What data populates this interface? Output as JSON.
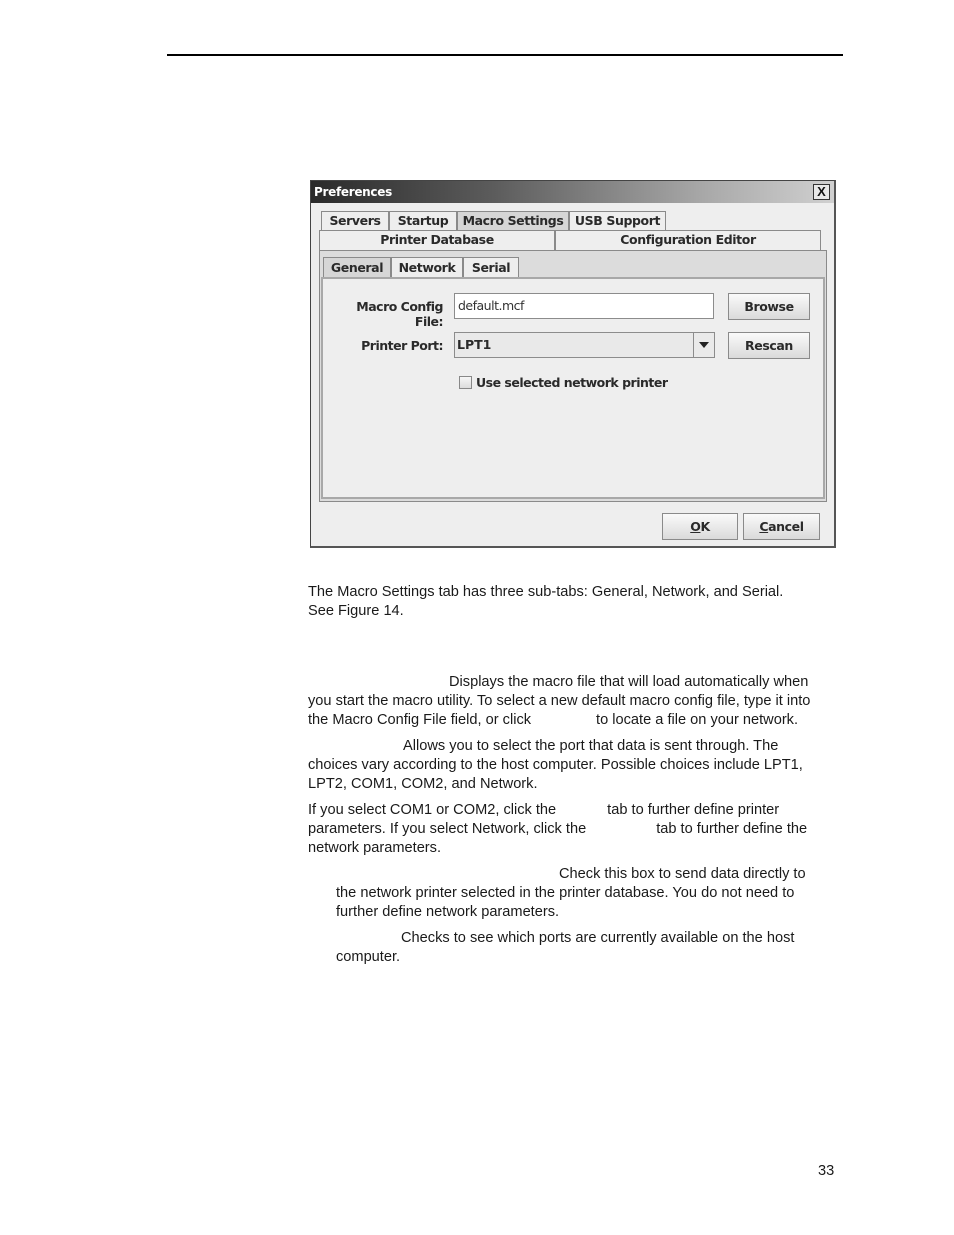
{
  "dialog": {
    "title": "Preferences",
    "close_label": "X",
    "tabs_row1": [
      "Servers",
      "Startup",
      "Macro Settings",
      "USB Support"
    ],
    "tabs_row2": [
      "Printer Database",
      "Configuration Editor"
    ],
    "selected_tab": "Macro Settings",
    "subtabs": [
      "General",
      "Network",
      "Serial"
    ],
    "selected_subtab": "General",
    "macro_config_label": "Macro Config File:",
    "macro_config_value": "default.mcf",
    "browse_label": "Browse",
    "printer_port_label": "Printer Port:",
    "printer_port_value": "LPT1",
    "rescan_label": "Rescan",
    "network_checkbox_label": "Use selected network printer",
    "network_checkbox_checked": false,
    "ok_label": "OK",
    "ok_mnemonic": "O",
    "ok_rest": "K",
    "cancel_label": "Cancel",
    "cancel_mnemonic": "C",
    "cancel_rest": "ancel"
  },
  "text": {
    "intro_line1": "The Macro Settings tab has three sub-tabs: General, Network, and Serial.",
    "intro_line2": "See Figure 14.",
    "macro_line1": "Displays the macro file that will load automatically when",
    "macro_line2": "you start the macro utility. To select a new default macro config file, type it into",
    "macro_line3a": "the Macro Config File field, or click",
    "macro_line3b": "to locate a file on your network.",
    "port_line1": "Allows you to select the port that data is sent through. The",
    "port_line2": "choices vary according to the host computer. Possible choices include LPT1,",
    "port_line3": "LPT2, COM1, COM2, and Network.",
    "com_line1a": "If you select COM1 or COM2, click the",
    "com_line1b": "tab to further define printer",
    "com_line2a": "parameters. If you select Network, click the",
    "com_line2b": "tab to further define the",
    "com_line3": "network parameters.",
    "check_line1": "Check this box to send data directly to",
    "check_line2": "the network printer selected in the printer database. You do not need to",
    "check_line3": "further define network parameters.",
    "rescan_line1": "Checks to see which ports are currently available on the host",
    "rescan_line2": "computer."
  },
  "footer": {
    "page_number": "33"
  }
}
